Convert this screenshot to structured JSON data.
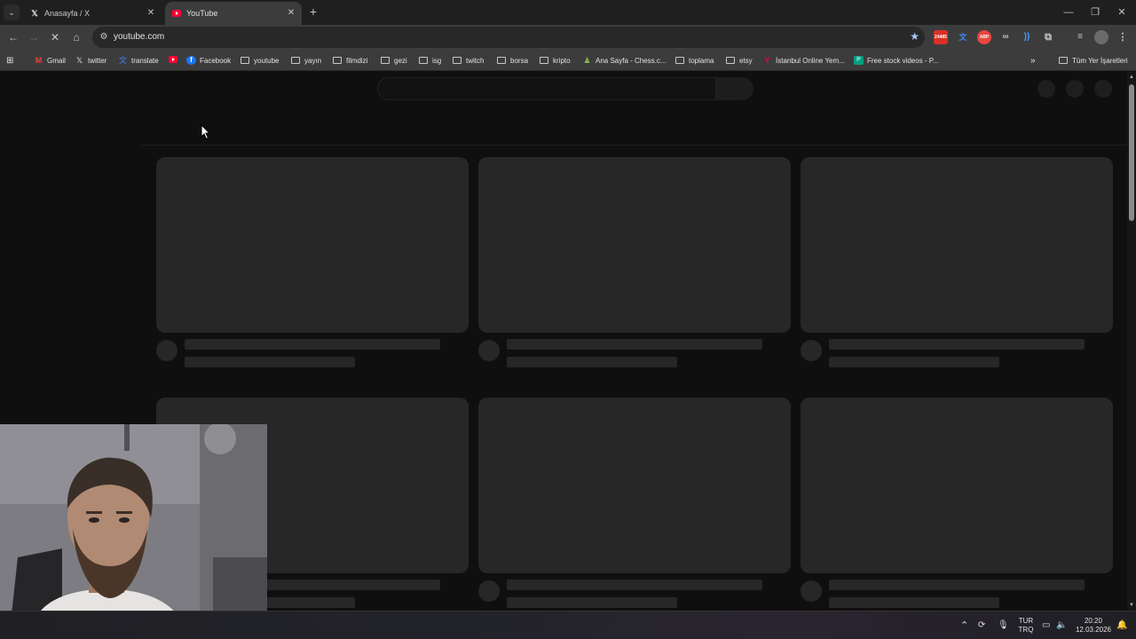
{
  "tabs": [
    {
      "title": "Anasayfa / X",
      "favicon": "x-logo-icon",
      "active": false
    },
    {
      "title": "YouTube",
      "favicon": "youtube-logo-icon",
      "active": true
    }
  ],
  "address_bar": {
    "url": "youtube.com"
  },
  "extensions": [
    {
      "name": "badge-extension-icon",
      "badge": "24485",
      "color": "#d93025"
    },
    {
      "name": "translate-extension-icon",
      "color": "#4285f4"
    },
    {
      "name": "adblock-extension-icon",
      "badge": "ABP",
      "color": "#e8453c"
    },
    {
      "name": "glasses-extension-icon",
      "color": "#c7c7c7"
    },
    {
      "name": "sound-extension-icon",
      "color": "#4a9eff"
    },
    {
      "name": "puzzle-extensions-icon",
      "color": "#c7c7c7"
    },
    {
      "name": "media-controls-icon",
      "color": "#c7c7c7"
    },
    {
      "name": "profile-avatar-icon",
      "color": "#8a8a8a"
    },
    {
      "name": "kebab-menu-icon",
      "color": "#c7c7c7"
    }
  ],
  "bookmarks": [
    {
      "label": "Gmail",
      "icon": "gmail-icon"
    },
    {
      "label": "twitter",
      "icon": "x-logo-icon"
    },
    {
      "label": "translate",
      "icon": "translate-icon"
    },
    {
      "label": "",
      "icon": "youtube-logo-icon"
    },
    {
      "label": "Facebook",
      "icon": "facebook-icon"
    },
    {
      "label": "youtube",
      "icon": "folder-icon"
    },
    {
      "label": "yayın",
      "icon": "folder-icon"
    },
    {
      "label": "filmdizi",
      "icon": "folder-icon"
    },
    {
      "label": "gezi",
      "icon": "folder-icon"
    },
    {
      "label": "isg",
      "icon": "folder-icon"
    },
    {
      "label": "twitch",
      "icon": "folder-icon"
    },
    {
      "label": "borsa",
      "icon": "folder-icon"
    },
    {
      "label": "kripto",
      "icon": "folder-icon"
    },
    {
      "label": "Ana Sayfa - Chess.c...",
      "icon": "chess-pawn-icon"
    },
    {
      "label": "toplama",
      "icon": "folder-icon"
    },
    {
      "label": "etsy",
      "icon": "folder-icon"
    },
    {
      "label": "İstanbul Online Yem...",
      "icon": "yemeksepeti-icon"
    },
    {
      "label": "Free stock videos - P...",
      "icon": "pexels-icon"
    }
  ],
  "bookmarks_overflow": "»",
  "all_bookmarks": "Tüm Yer İşaretleri",
  "taskbar": {
    "language_top": "TUR",
    "language_bottom": "TRQ",
    "time": "20:20",
    "date": "12.03.2026"
  }
}
